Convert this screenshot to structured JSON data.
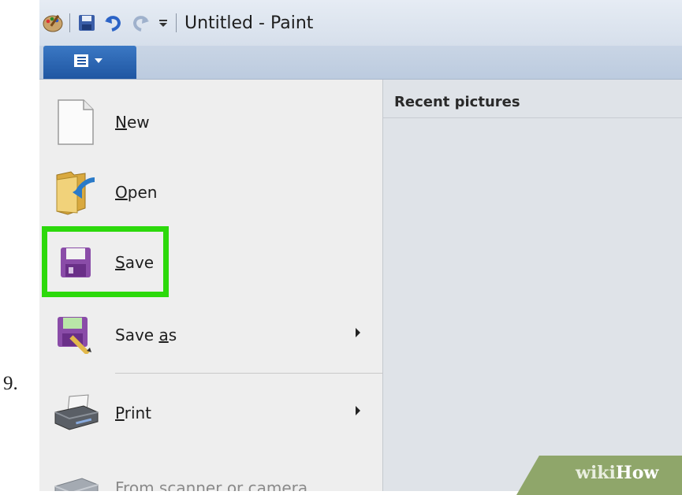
{
  "step": {
    "number": "9."
  },
  "window": {
    "title": "Untitled - Paint"
  },
  "menu": {
    "items": [
      {
        "id": "new",
        "prefix": "",
        "accel": "N",
        "rest": "ew",
        "has_submenu": false,
        "disabled": false
      },
      {
        "id": "open",
        "prefix": "",
        "accel": "O",
        "rest": "pen",
        "has_submenu": false,
        "disabled": false
      },
      {
        "id": "save",
        "prefix": "",
        "accel": "S",
        "rest": "ave",
        "has_submenu": false,
        "disabled": false,
        "highlighted": true
      },
      {
        "id": "save-as",
        "prefix": "Save ",
        "accel": "a",
        "rest": "s",
        "has_submenu": true,
        "disabled": false
      },
      {
        "id": "print",
        "prefix": "",
        "accel": "P",
        "rest": "rint",
        "has_submenu": true,
        "disabled": false
      },
      {
        "id": "scanner",
        "prefix": "From scanner or camera",
        "accel": "",
        "rest": "",
        "has_submenu": false,
        "disabled": true
      }
    ]
  },
  "recent": {
    "title": "Recent pictures"
  },
  "watermark": {
    "brand_prefix": "wiki",
    "brand_suffix": "How"
  },
  "colors": {
    "highlight": "#2cd90b",
    "app_button": "#2a64b0"
  },
  "icons": [
    "paint-palette-icon",
    "save-icon",
    "undo-icon",
    "redo-icon",
    "customize-qat-icon",
    "app-menu-icon",
    "new-file-icon",
    "open-folder-icon",
    "floppy-icon",
    "save-as-icon",
    "printer-icon",
    "scanner-icon"
  ]
}
